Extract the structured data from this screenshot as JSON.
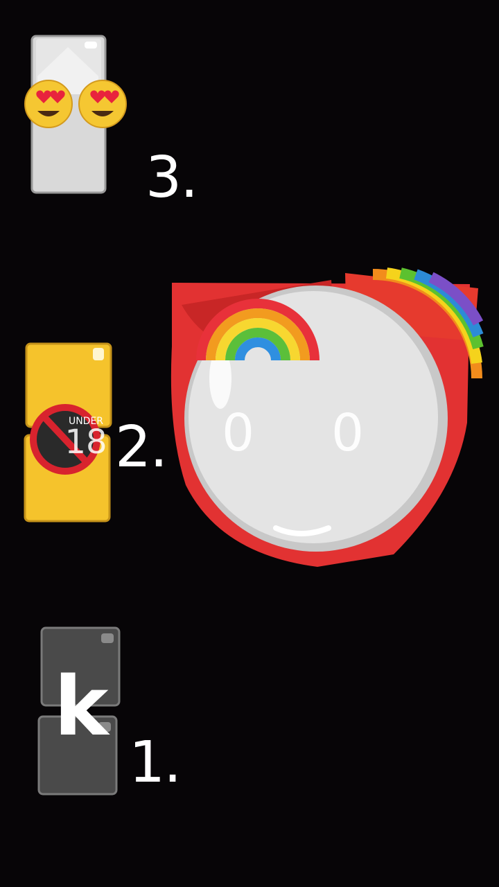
{
  "background_color": "#070507",
  "items": [
    {
      "rank_label": "3.",
      "icon": "white-tile-with-heart-eyes-emojis-icon",
      "tile_color": "#dcdcdc"
    },
    {
      "rank_label": "2.",
      "icon": "yellow-tile-with-under-18-icon",
      "tile_color": "#f5c32c",
      "badge_top_text": "UNDER",
      "badge_number": "18",
      "sticker": {
        "icon": "white-face-with-rainbow-icon",
        "eye_left": "0",
        "eye_right": "0",
        "body_color": "#e23232"
      }
    },
    {
      "rank_label": "1.",
      "icon": "dark-tile-with-letter-k-icon",
      "tile_color": "#4a4a4a",
      "letter": "k"
    }
  ]
}
